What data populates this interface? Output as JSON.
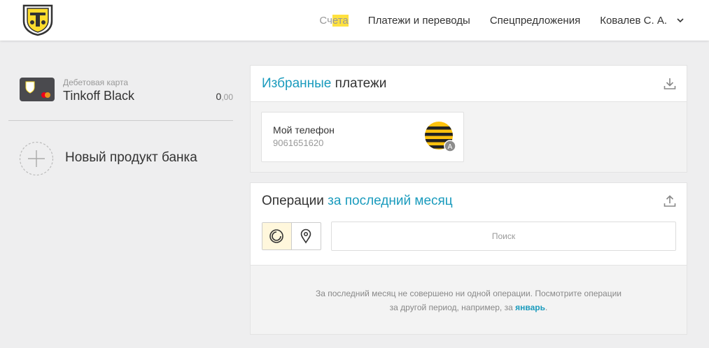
{
  "header": {
    "logo": "tinkoff-shield-logo",
    "nav": {
      "accounts_pre": "Сч",
      "accounts_hl": "ета",
      "payments": "Платежи и переводы",
      "offers": "Спецпредложения",
      "user": "Ковалев С. А."
    }
  },
  "sidebar": {
    "account": {
      "type": "Дебетовая карта",
      "name": "Tinkoff Black",
      "balance_int": "0",
      "balance_dec": ",00"
    },
    "new_product": "Новый продукт банка"
  },
  "favorites": {
    "title_accent": "Избранные",
    "title_rest": " платежи",
    "item": {
      "name": "Мой телефон",
      "number": "9061651620",
      "badge": "A"
    }
  },
  "operations": {
    "title": "Операции ",
    "title_accent": "за последний месяц",
    "search_placeholder": "Поиск",
    "empty_line1": "За последний месяц не совершено ни одной операции. Посмотрите операции",
    "empty_line2_pre": "за другой период, например, за ",
    "empty_link": "январь",
    "empty_line2_post": "."
  },
  "colors": {
    "accent": "#1a9bbd",
    "highlight": "#ffe13f",
    "background": "#eeeeef"
  }
}
